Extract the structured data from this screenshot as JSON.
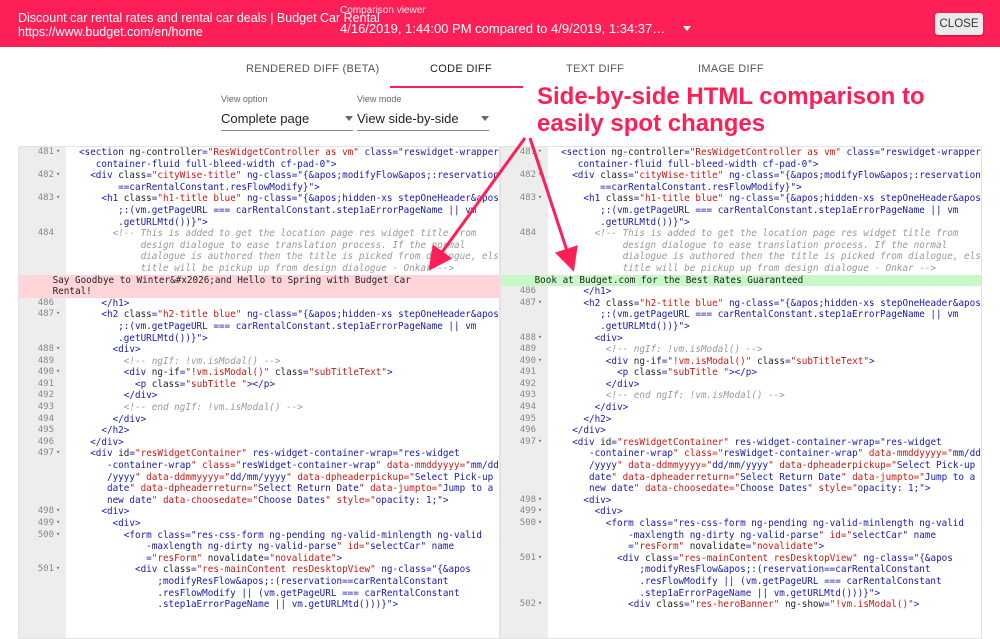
{
  "header": {
    "page_title": "Discount car rental rates and rental car deals | Budget Car Rental",
    "url": "https://www.budget.com/en/home",
    "comparison_label": "Comparison viewer",
    "comparison_value": "4/16/2019, 1:44:00 PM compared to 4/9/2019, 1:34:37…",
    "close_label": "CLOSE"
  },
  "tabs": [
    "RENDERED DIFF (BETA)",
    "CODE DIFF",
    "TEXT DIFF",
    "IMAGE DIFF"
  ],
  "active_tab": "CODE DIFF",
  "view_option": {
    "label": "View option",
    "value": "Complete page"
  },
  "view_mode": {
    "label": "View mode",
    "value": "View side-by-side"
  },
  "annotation": "Side-by-side HTML comparison to easily spot changes",
  "colors": {
    "accent": "#ff1f57",
    "removed": "#ffd5d9",
    "added": "#c8f7c8"
  },
  "left_pane": [
    {
      "n": "481",
      "f": true,
      "lines": [
        "<section ng-controller=\"ResWidgetController as vm\" class=\"reswidget-wrapper",
        "   container-fluid full-bleed-width cf-pad-0\">"
      ]
    },
    {
      "n": "482",
      "f": true,
      "lines": [
        "  <div class=\"cityWise-title\" ng-class=\"{&apos;modifyFlow&apos;:reservation",
        "       ==carRentalConstant.resFlowModify}\">"
      ]
    },
    {
      "n": "483",
      "f": true,
      "lines": [
        "    <h1 class=\"h1-title blue\" ng-class=\"{&apos;hidden-xs stepOneHeader&apos",
        "       ;:(vm.getPageURL === carRentalConstant.step1aErrorPageName || vm",
        "       .getURLMtd())}\">"
      ]
    },
    {
      "n": "484",
      "f": false,
      "lines": [
        "      <!-- This is added to get the location page res widget title from",
        "           design dialogue to ease translation process. If the normal",
        "           dialogue is authored then the title is picked from dialogue, else",
        "           title will be pickup up from design dialogue - Onkar -->"
      ]
    },
    {
      "n": "485",
      "f": false,
      "hl": "red",
      "lines": [
        "      Say Goodbye to Winter&#x2026;and Hello to Spring with Budget Car",
        "      Rental!"
      ]
    },
    {
      "n": "486",
      "f": false,
      "lines": [
        "    </h1>"
      ]
    },
    {
      "n": "487",
      "f": true,
      "lines": [
        "    <h2 class=\"h2-title blue\" ng-class=\"{&apos;hidden-xs stepOneHeader&apos",
        "       ;:(vm.getPageURL === carRentalConstant.step1aErrorPageName || vm",
        "       .getURLMtd())}\">"
      ]
    },
    {
      "n": "488",
      "f": true,
      "lines": [
        "      <div>"
      ]
    },
    {
      "n": "489",
      "f": false,
      "lines": [
        "        <!-- ngIf: !vm.isModal() -->"
      ]
    },
    {
      "n": "490",
      "f": true,
      "lines": [
        "        <div ng-if=\"!vm.isModal()\" class=\"subTitleText\">"
      ]
    },
    {
      "n": "491",
      "f": false,
      "lines": [
        "          <p class=\"subTitle \"></p>"
      ]
    },
    {
      "n": "492",
      "f": false,
      "lines": [
        "        </div>"
      ]
    },
    {
      "n": "493",
      "f": false,
      "lines": [
        "        <!-- end ngIf: !vm.isModal() -->"
      ]
    },
    {
      "n": "494",
      "f": false,
      "lines": [
        "      </div>"
      ]
    },
    {
      "n": "495",
      "f": false,
      "lines": [
        "    </h2>"
      ]
    },
    {
      "n": "496",
      "f": false,
      "lines": [
        "  </div>"
      ]
    },
    {
      "n": "497",
      "f": true,
      "lines": [
        "  <div id=\"resWidgetContainer\" res-widget-container-wrap=\"res-widget",
        "     -container-wrap\" class=\"resWidget-container-wrap\" data-mmddyyyy=\"mm/dd",
        "     /yyyy\" data-ddmmyyyy=\"dd/mm/yyyy\" data-dpheaderpickup=\"Select Pick-up",
        "     date\" data-dpheaderreturn=\"Select Return Date\" data-jumpto=\"Jump to a",
        "     new date\" data-choosedate=\"Choose Dates\" style=\"opacity: 1;\">"
      ]
    },
    {
      "n": "498",
      "f": true,
      "lines": [
        "    <div>"
      ]
    },
    {
      "n": "499",
      "f": true,
      "lines": [
        "      <div>"
      ]
    },
    {
      "n": "500",
      "f": true,
      "lines": [
        "        <form class=\"res-css-form ng-pending ng-valid-minlength ng-valid",
        "            -maxlength ng-dirty ng-valid-parse\" id=\"selectCar\" name",
        "            =\"resForm\" novalidate=\"novalidate\">"
      ]
    },
    {
      "n": "501",
      "f": true,
      "lines": [
        "          <div class=\"res-mainContent resDesktopView\" ng-class=\"{&apos",
        "              ;modifyResFlow&apos;:(reservation==carRentalConstant",
        "              .resFlowModify || (vm.getPageURL === carRentalConstant",
        "              .step1aErrorPageName || vm.getURLMtd()))}\">"
      ]
    }
  ],
  "right_pane": [
    {
      "n": "481",
      "f": true,
      "lines": [
        "<section ng-controller=\"ResWidgetController as vm\" class=\"reswidget-wrapper",
        "   container-fluid full-bleed-width cf-pad-0\">"
      ]
    },
    {
      "n": "482",
      "f": true,
      "lines": [
        "  <div class=\"cityWise-title\" ng-class=\"{&apos;modifyFlow&apos;:reservation",
        "       ==carRentalConstant.resFlowModify}\">"
      ]
    },
    {
      "n": "483",
      "f": true,
      "lines": [
        "    <h1 class=\"h1-title blue\" ng-class=\"{&apos;hidden-xs stepOneHeader&apos",
        "       ;:(vm.getPageURL === carRentalConstant.step1aErrorPageName || vm",
        "       .getURLMtd())}\">"
      ]
    },
    {
      "n": "484",
      "f": false,
      "lines": [
        "      <!-- This is added to get the location page res widget title from",
        "           design dialogue to ease translation process. If the normal",
        "           dialogue is authored then the title is picked from dialogue, else",
        "           title will be pickup up from design dialogue - Onkar -->"
      ]
    },
    {
      "n": "485",
      "f": false,
      "hl": "green",
      "lines": [
        "      Book at Budget.com for the Best Rates Guaranteed"
      ]
    },
    {
      "n": "486",
      "f": false,
      "lines": [
        "    </h1>"
      ]
    },
    {
      "n": "487",
      "f": true,
      "lines": [
        "    <h2 class=\"h2-title blue\" ng-class=\"{&apos;hidden-xs stepOneHeader&apos",
        "       ;:(vm.getPageURL === carRentalConstant.step1aErrorPageName || vm",
        "       .getURLMtd())}\">"
      ]
    },
    {
      "n": "488",
      "f": true,
      "lines": [
        "      <div>"
      ]
    },
    {
      "n": "489",
      "f": false,
      "lines": [
        "        <!-- ngIf: !vm.isModal() -->"
      ]
    },
    {
      "n": "490",
      "f": true,
      "lines": [
        "        <div ng-if=\"!vm.isModal()\" class=\"subTitleText\">"
      ]
    },
    {
      "n": "491",
      "f": false,
      "lines": [
        "          <p class=\"subTitle \"></p>"
      ]
    },
    {
      "n": "492",
      "f": false,
      "lines": [
        "        </div>"
      ]
    },
    {
      "n": "493",
      "f": false,
      "lines": [
        "        <!-- end ngIf: !vm.isModal() -->"
      ]
    },
    {
      "n": "494",
      "f": false,
      "lines": [
        "      </div>"
      ]
    },
    {
      "n": "495",
      "f": false,
      "lines": [
        "    </h2>"
      ]
    },
    {
      "n": "496",
      "f": false,
      "lines": [
        "  </div>"
      ]
    },
    {
      "n": "497",
      "f": true,
      "lines": [
        "  <div id=\"resWidgetContainer\" res-widget-container-wrap=\"res-widget",
        "     -container-wrap\" class=\"resWidget-container-wrap\" data-mmddyyyy=\"mm/dd",
        "     /yyyy\" data-ddmmyyyy=\"dd/mm/yyyy\" data-dpheaderpickup=\"Select Pick-up",
        "     date\" data-dpheaderreturn=\"Select Return Date\" data-jumpto=\"Jump to a",
        "     new date\" data-choosedate=\"Choose Dates\" style=\"opacity: 1;\">"
      ]
    },
    {
      "n": "498",
      "f": true,
      "lines": [
        "    <div>"
      ]
    },
    {
      "n": "499",
      "f": true,
      "lines": [
        "      <div>"
      ]
    },
    {
      "n": "500",
      "f": true,
      "lines": [
        "        <form class=\"res-css-form ng-pending ng-valid-minlength ng-valid",
        "            -maxlength ng-dirty ng-valid-parse\" id=\"selectCar\" name",
        "            =\"resForm\" novalidate=\"novalidate\">"
      ]
    },
    {
      "n": "501",
      "f": true,
      "lines": [
        "          <div class=\"res-mainContent resDesktopView\" ng-class=\"{&apos",
        "              ;modifyResFlow&apos;:(reservation==carRentalConstant",
        "              .resFlowModify || (vm.getPageURL === carRentalConstant",
        "              .step1aErrorPageName || vm.getURLMtd()))}\">"
      ]
    },
    {
      "n": "502",
      "f": true,
      "lines": [
        "            <div class=\"res-heroBanner\" ng-show=\"!vm.isModal()\">"
      ]
    }
  ]
}
